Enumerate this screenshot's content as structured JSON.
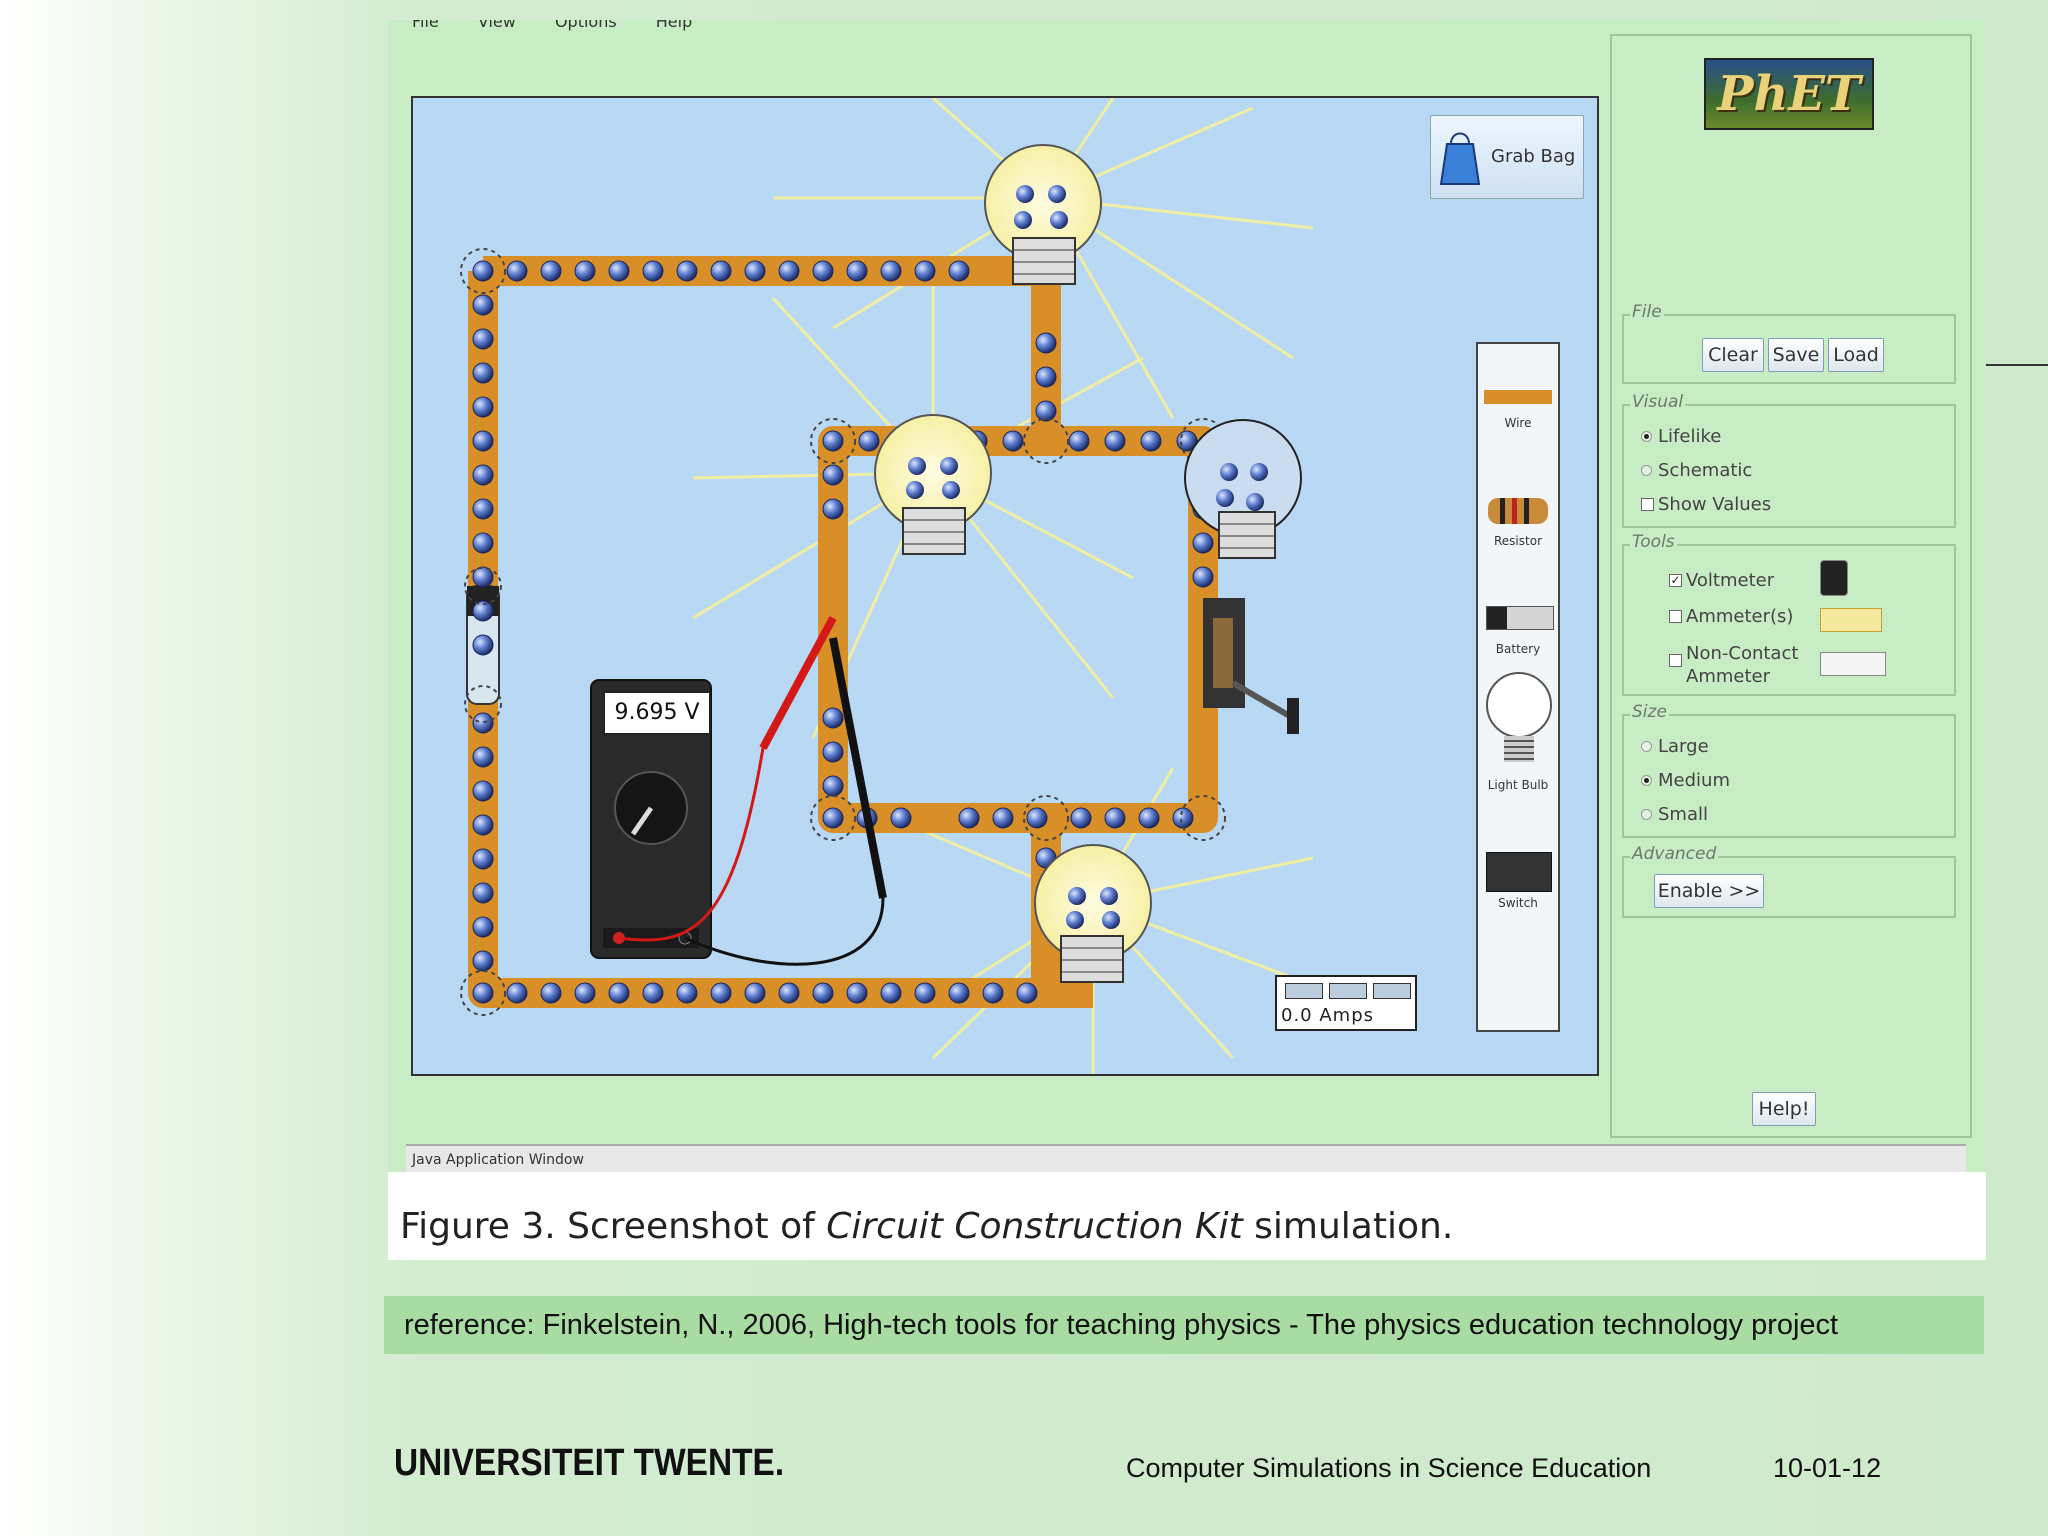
{
  "menu": [
    "File",
    "View",
    "Options",
    "Help"
  ],
  "grab_bag": "Grab Bag",
  "toolbox": {
    "items": [
      "Wire",
      "Resistor",
      "Battery",
      "Light Bulb",
      "Switch"
    ]
  },
  "voltmeter": {
    "reading": "9.695 V"
  },
  "ammeter": {
    "reading": "0.0 Amps"
  },
  "panel": {
    "logo": "PhET",
    "file": {
      "title": "File",
      "buttons": [
        "Clear",
        "Save",
        "Load"
      ]
    },
    "visual": {
      "title": "Visual",
      "options": [
        "Lifelike",
        "Schematic"
      ],
      "selected": "Lifelike",
      "show_values": "Show Values"
    },
    "tools": {
      "title": "Tools",
      "voltmeter": "Voltmeter",
      "ammeters": "Ammeter(s)",
      "noncontact_line1": "Non-Contact",
      "noncontact_line2": "Ammeter"
    },
    "size": {
      "title": "Size",
      "options": [
        "Large",
        "Medium",
        "Small"
      ],
      "selected": "Medium"
    },
    "advanced": {
      "title": "Advanced",
      "enable": "Enable >>"
    },
    "help": "Help!"
  },
  "status_bar": "Java Application Window",
  "caption": {
    "prefix": "Figure 3. Screenshot of ",
    "title": "Circuit Construction Kit",
    "suffix": " simulation."
  },
  "reference": "reference: Finkelstein, N., 2006, High-tech tools for teaching physics - The physics education technology project",
  "footer": {
    "university": "UNIVERSITEIT TWENTE.",
    "course": "Computer Simulations in Science Education",
    "date": "10-01-12"
  }
}
